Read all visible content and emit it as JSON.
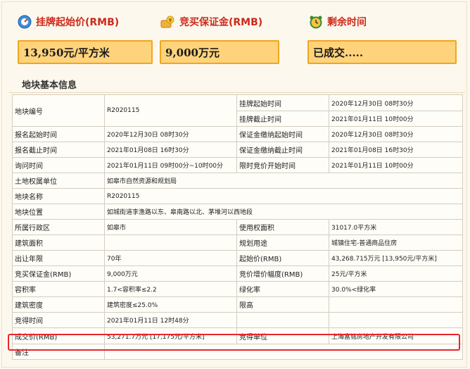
{
  "headers": {
    "start_price": "挂牌起始价(RMB)",
    "deposit": "竞买保证金(RMB)",
    "remaining": "剩余时间"
  },
  "values": {
    "start_price": "13,950元/平方米",
    "deposit": "9,000万元",
    "remaining": "已成交....."
  },
  "section_title": "地块基本信息",
  "rows": [
    [
      "地块编号",
      "R2020115",
      "挂牌起始时间",
      "2020年12月30日 08时30分"
    ],
    [
      "",
      "",
      "挂牌截止时间",
      "2021年01月11日 10时00分"
    ],
    [
      "报名起始时间",
      "2020年12月30日 08时30分",
      "保证金缴纳起始时间",
      "2020年12月30日 08时30分"
    ],
    [
      "报名截止时间",
      "2021年01月08日 16时30分",
      "保证金缴纳截止时间",
      "2021年01月08日 16时30分"
    ],
    [
      "询问时间",
      "2021年01月11日 09时00分~10时00分",
      "限时竞价开始时间",
      "2021年01月11日 10时00分"
    ],
    [
      "土地权属单位",
      "如皋市自然资源和规划局",
      "",
      ""
    ],
    [
      "地块名称",
      "R2020115",
      "",
      ""
    ],
    [
      "地块位置",
      "如城街道李渔路以东、皋南路以北、茅堆河以西地段",
      "",
      ""
    ],
    [
      "所属行政区",
      "如皋市",
      "使用权面积",
      "31017.0平方米"
    ],
    [
      "建筑面积",
      "",
      "规划用途",
      "城镇住宅-普通商品住房"
    ],
    [
      "出让年限",
      "70年",
      "起始价(RMB)",
      "43,268.715万元 [13,950元/平方米]"
    ],
    [
      "竞买保证金(RMB)",
      "9,000万元",
      "竞价增价幅度(RMB)",
      "25元/平方米"
    ],
    [
      "容积率",
      "1.7<容积率≤2.2",
      "绿化率",
      "30.0%<绿化率"
    ],
    [
      "建筑密度",
      "建筑密度≤25.0%",
      "限高",
      ""
    ],
    [
      "竞得时间",
      "2021年01月11日 12时48分",
      "",
      ""
    ],
    [
      "成交价(RMB)",
      "53,271.7万元 [17,175元/平方米]",
      "竞得单位",
      "上海富铭房地产开发有限公司"
    ],
    [
      "备注",
      "",
      "",
      ""
    ]
  ]
}
